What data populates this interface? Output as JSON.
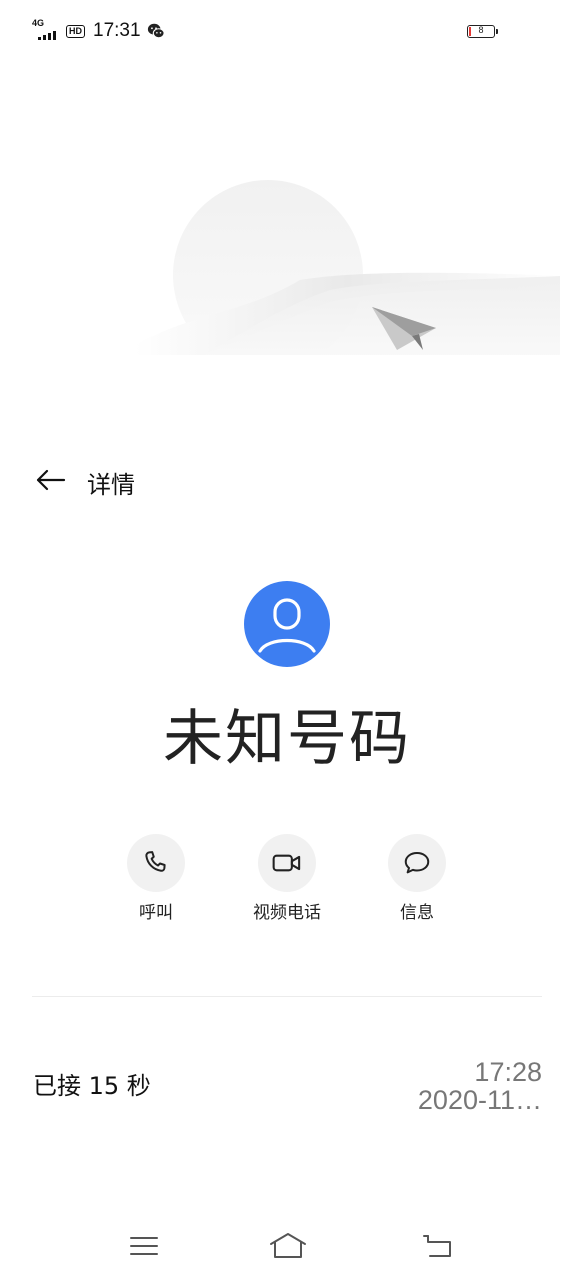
{
  "status_bar": {
    "network": "4G",
    "hd": "HD",
    "time": "17:31",
    "battery_level": "8"
  },
  "header": {
    "title": "详情"
  },
  "contact": {
    "name": "未知号码",
    "avatar_color": "#3d7ef1"
  },
  "actions": [
    {
      "label": "呼叫",
      "icon": "phone-icon"
    },
    {
      "label": "视频电话",
      "icon": "video-camera-icon"
    },
    {
      "label": "信息",
      "icon": "message-bubble-icon"
    }
  ],
  "call_record": {
    "status": "已接 15 秒",
    "time": "17:28",
    "date": "2020-11…"
  },
  "nav_bar": [
    "menu-icon",
    "home-icon",
    "back-icon"
  ]
}
